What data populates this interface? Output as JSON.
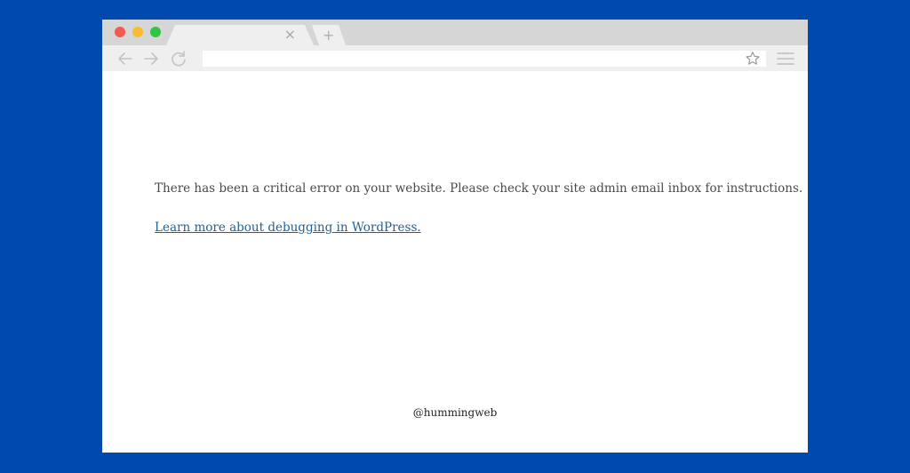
{
  "browser": {
    "tab_close_glyph": "×",
    "new_tab_glyph": "+",
    "icons": [
      "back-arrow-icon",
      "forward-arrow-icon",
      "reload-icon",
      "star-icon",
      "hamburger-menu-icon"
    ]
  },
  "page": {
    "error_message": "There has been a critical error on your website. Please check your site admin email inbox for instructions.",
    "learn_more_link": "Learn more about debugging in WordPress."
  },
  "credit": "@hummingweb",
  "colors": {
    "background": "#004aad",
    "link": "#1f5f9a",
    "close_dot": "#f25a52",
    "minimize_dot": "#f8bd2c",
    "maximize_dot": "#32c444"
  }
}
